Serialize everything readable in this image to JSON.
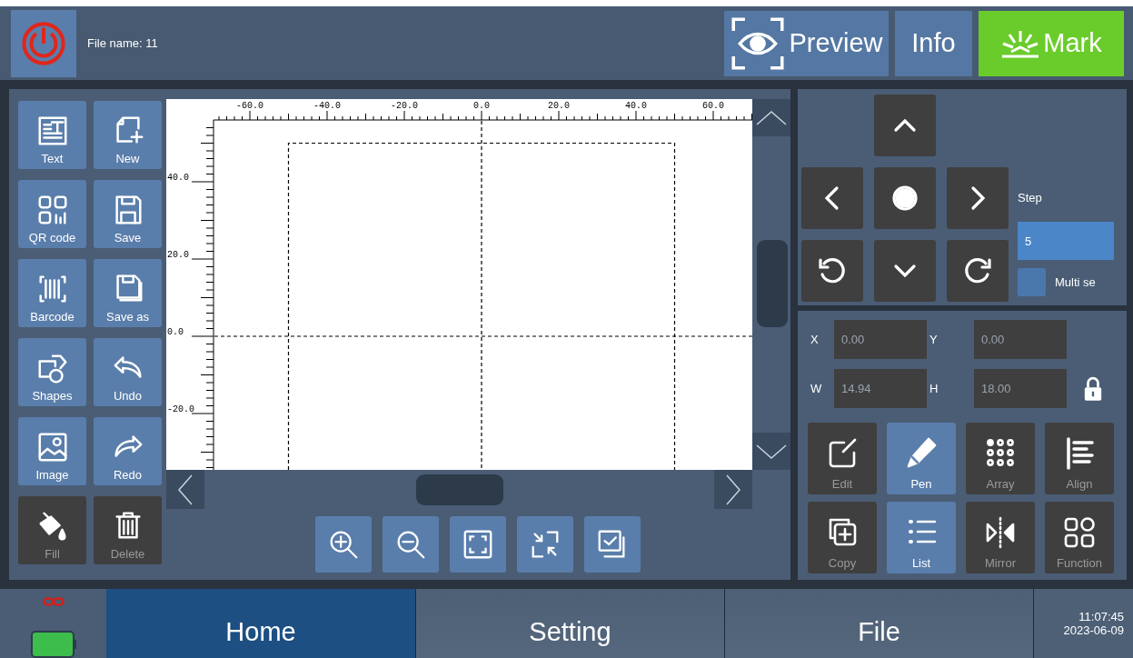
{
  "header": {
    "file_name": "File name: 11",
    "buttons": [
      {
        "label": "Preview",
        "kind": "preview"
      },
      {
        "label": "Info",
        "kind": "info"
      },
      {
        "label": "Mark",
        "kind": "mark"
      }
    ]
  },
  "tools": [
    {
      "label": "Text",
      "disabled": false
    },
    {
      "label": "New",
      "disabled": false
    },
    {
      "label": "QR code",
      "disabled": false
    },
    {
      "label": "Save",
      "disabled": false
    },
    {
      "label": "Barcode",
      "disabled": false
    },
    {
      "label": "Save as",
      "disabled": false
    },
    {
      "label": "Shapes",
      "disabled": false
    },
    {
      "label": "Undo",
      "disabled": false
    },
    {
      "label": "Image",
      "disabled": false
    },
    {
      "label": "Redo",
      "disabled": false
    },
    {
      "label": "Fill",
      "disabled": true
    },
    {
      "label": "Delete",
      "disabled": true
    }
  ],
  "ruler": {
    "x_labels": [
      "-60.0",
      "-40.0",
      "-20.0",
      "0.0",
      "20.0",
      "40.0",
      "60.0"
    ],
    "y_labels": [
      "40.0",
      "20.0",
      "0.0",
      "-20.0"
    ]
  },
  "jog": {
    "step_label": "Step",
    "step_value": "5",
    "multi_label": "Multi se",
    "multi_checked": false
  },
  "position": {
    "fields": [
      {
        "label": "X",
        "value": "0.00"
      },
      {
        "label": "Y",
        "value": "0.00"
      },
      {
        "label": "W",
        "value": "14.94"
      },
      {
        "label": "H",
        "value": "18.00"
      }
    ],
    "locked": true
  },
  "actions": [
    {
      "label": "Edit",
      "selected": false
    },
    {
      "label": "Pen",
      "selected": true
    },
    {
      "label": "Array",
      "selected": false
    },
    {
      "label": "Align",
      "selected": false
    },
    {
      "label": "Copy",
      "selected": false
    },
    {
      "label": "List",
      "selected": true
    },
    {
      "label": "Mirror",
      "selected": false
    },
    {
      "label": "Function",
      "selected": false
    }
  ],
  "nav": {
    "tabs": [
      {
        "label": "Home",
        "selected": true
      },
      {
        "label": "Setting",
        "selected": false
      },
      {
        "label": "File",
        "selected": false
      }
    ],
    "time": "11:07:45",
    "date": "2023-06-09"
  }
}
